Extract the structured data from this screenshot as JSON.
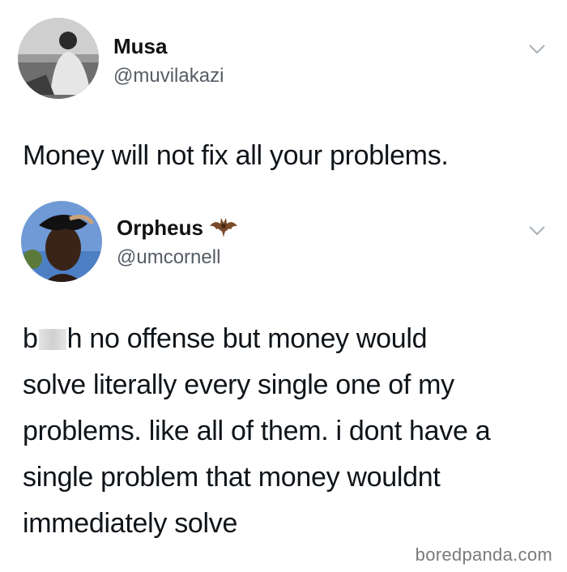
{
  "tweets": [
    {
      "name": "Musa",
      "handle": "@muvilakazi",
      "text": "Money will not fix all your problems."
    },
    {
      "name": "Orpheus",
      "name_emoji_icon": "bat-icon",
      "handle": "@umcornell",
      "text_prefix": "b",
      "text_after_censor": "h no offense but money would",
      "text_rest": "solve literally every single one of my\nproblems. like all of them. i dont have a\nsingle problem that money wouldnt\nimmediately solve"
    }
  ],
  "watermark": "boredpanda.com",
  "colors": {
    "text": "#0f1419",
    "handle": "#555c64",
    "chevron": "#a6b0b8"
  }
}
